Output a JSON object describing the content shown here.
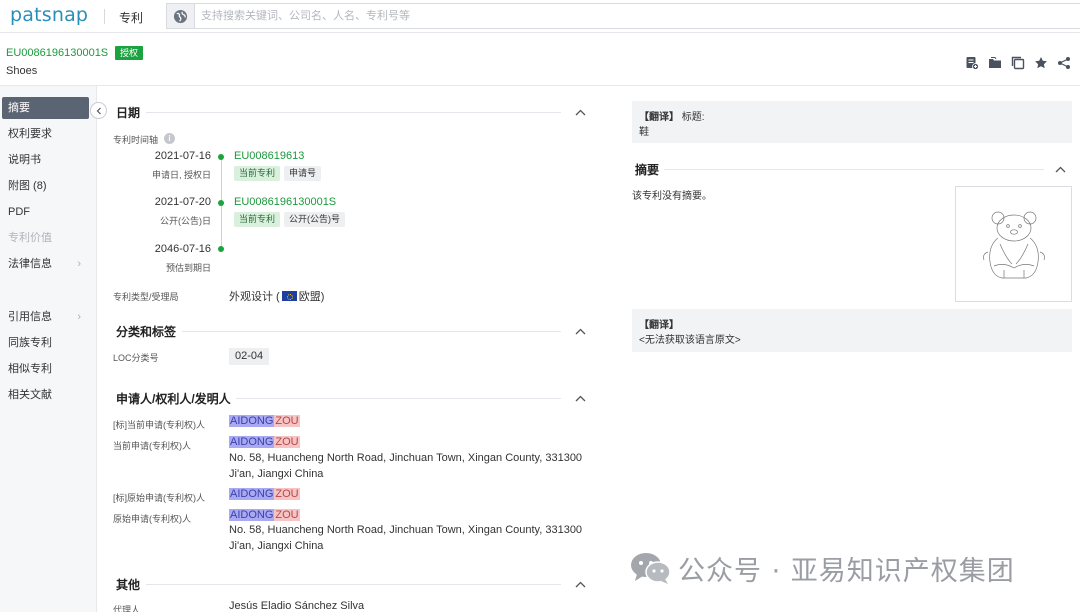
{
  "topbar": {
    "logo_text": "patsnap",
    "module_label": "专利",
    "search_placeholder": "支持搜索关键词、公司名、人名、专利号等"
  },
  "patent": {
    "number": "EU0086196130001S",
    "status": "授权",
    "title": "Shoes"
  },
  "toolbar": {
    "icons": [
      "note-add-icon",
      "folder-icon",
      "copy-icon",
      "star-icon",
      "share-icon"
    ]
  },
  "nav": {
    "items": [
      {
        "label": "摘要",
        "active": true
      },
      {
        "label": "权利要求"
      },
      {
        "label": "说明书"
      },
      {
        "label": "附图 (8)"
      },
      {
        "label": "PDF"
      },
      {
        "label": "专利价值",
        "disabled": true
      },
      {
        "label": "法律信息",
        "chevron": true
      },
      {
        "label": "引用信息",
        "chevron": true
      },
      {
        "label": "同族专利"
      },
      {
        "label": "相似专利"
      },
      {
        "label": "相关文献"
      }
    ]
  },
  "dates": {
    "title": "日期",
    "timeline_label": "专利时间轴",
    "events": [
      {
        "date": "2021-07-16",
        "sub": "申请日, 授权日",
        "link": "EU008619613",
        "chips": [
          "当前专利",
          "申请号"
        ]
      },
      {
        "date": "2021-07-20",
        "sub": "公开(公告)日",
        "link": "EU0086196130001S",
        "chips": [
          "当前专利",
          "公开(公告)号"
        ]
      },
      {
        "date": "2046-07-16",
        "sub": "预估到期日"
      }
    ],
    "type_label": "专利类型/受理局",
    "type_value_prefix": "外观设计 (",
    "type_value_suffix": "欧盟)"
  },
  "classification": {
    "title": "分类和标签",
    "loc_label": "LOC分类号",
    "loc_value": "02-04"
  },
  "applicants": {
    "title": "申请人/权利人/发明人",
    "rows": [
      {
        "label": "[标]当前申请(专利权)人",
        "first": "AIDONG",
        "last": "ZOU"
      },
      {
        "label": "当前申请(专利权)人",
        "first": "AIDONG",
        "last": "ZOU",
        "address": "No. 58, Huancheng North Road, Jinchuan Town, Xingan County, 331300 Ji'an, Jiangxi China"
      },
      {
        "label": "[标]原始申请(专利权)人",
        "first": "AIDONG",
        "last": "ZOU"
      },
      {
        "label": "原始申请(专利权)人",
        "first": "AIDONG",
        "last": "ZOU",
        "address": "No. 58, Huancheng North Road, Jinchuan Town, Xingan County, 331300 Ji'an, Jiangxi China"
      }
    ]
  },
  "other": {
    "title": "其他",
    "agent_label": "代理人",
    "agent_value": "Jesús Eladio Sánchez Silva"
  },
  "right": {
    "translate_head": "【翻译】",
    "translate_title_label": "标题:",
    "translate_title_value": "鞋",
    "abstract_title": "摘要",
    "abstract_text": "该专利没有摘要。",
    "translate2_head": "【翻译】",
    "translate2_text": "<无法获取该语言原文>"
  },
  "watermark": {
    "text": "公众号 · 亚易知识产权集团"
  },
  "colors": {
    "brand": "#2a8fb8",
    "green": "#1aa33f",
    "nav_active": "#5b6473",
    "highlight_first": "#a8a9f0",
    "highlight_last": "#f6c4c4"
  }
}
